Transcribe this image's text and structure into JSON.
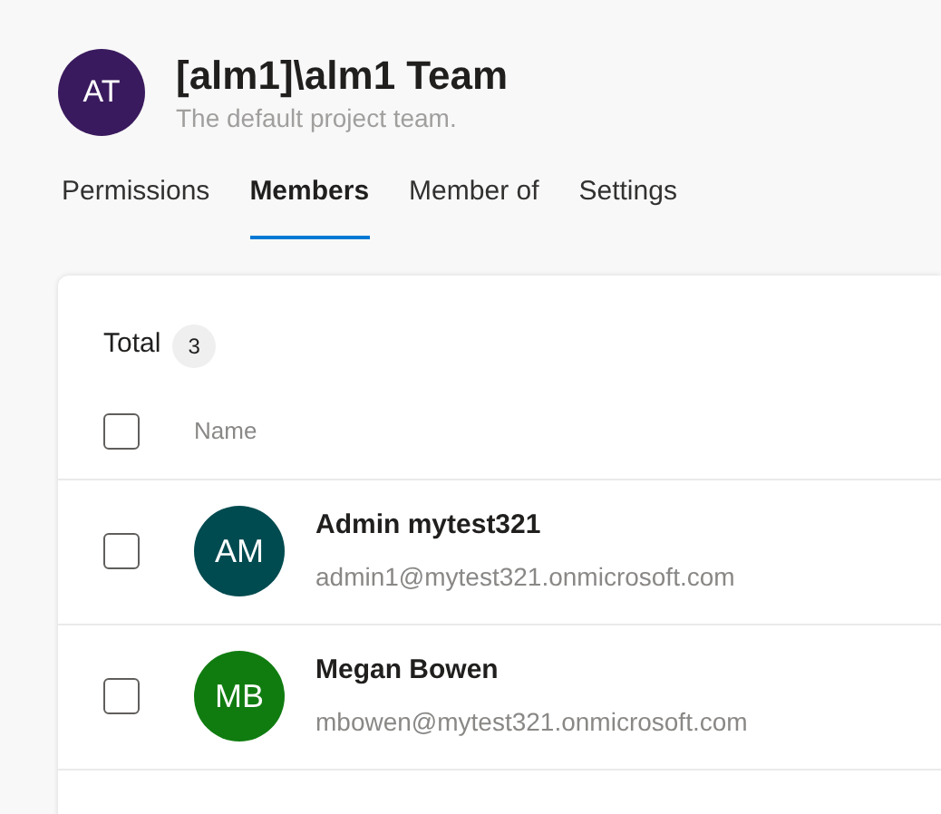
{
  "team": {
    "initials": "AT",
    "name": "[alm1]\\alm1 Team",
    "description": "The default project team."
  },
  "tabs": [
    {
      "label": "Permissions",
      "selected": false
    },
    {
      "label": "Members",
      "selected": true
    },
    {
      "label": "Member of",
      "selected": false
    },
    {
      "label": "Settings",
      "selected": false
    }
  ],
  "total": {
    "label": "Total",
    "count": "3"
  },
  "table": {
    "select_all": {
      "checked": false
    },
    "columns": [
      "Name"
    ],
    "rows": [
      {
        "initials": "AM",
        "color": "#004b50",
        "name": "Admin mytest321",
        "email": "admin1@mytest321.onmicrosoft.com",
        "checked": false
      },
      {
        "initials": "MB",
        "color": "#107c10",
        "name": "Megan Bowen",
        "email": "mbowen@mytest321.onmicrosoft.com",
        "checked": false
      }
    ]
  }
}
